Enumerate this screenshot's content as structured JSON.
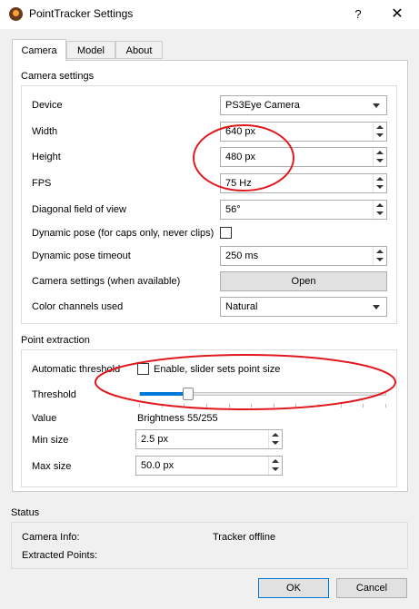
{
  "window": {
    "title": "PointTracker Settings",
    "help_label": "?",
    "close_label": "✕",
    "icon": "app-logo-icon"
  },
  "tabs": [
    {
      "label": "Camera",
      "active": true
    },
    {
      "label": "Model",
      "active": false
    },
    {
      "label": "About",
      "active": false
    }
  ],
  "camera": {
    "group_title": "Camera settings",
    "device": {
      "label": "Device",
      "value": "PS3Eye Camera"
    },
    "width": {
      "label": "Width",
      "value": "640 px"
    },
    "height": {
      "label": "Height",
      "value": "480 px"
    },
    "fps": {
      "label": "FPS",
      "value": "75 Hz"
    },
    "fov": {
      "label": "Diagonal field of view",
      "value": "56°"
    },
    "dynamic_pose": {
      "label": "Dynamic pose (for caps only, never clips)",
      "checked": false
    },
    "dynamic_timeout": {
      "label": "Dynamic pose timeout",
      "value": "250 ms"
    },
    "cam_settings": {
      "label": "Camera settings (when available)",
      "button": "Open"
    },
    "color": {
      "label": "Color channels used",
      "value": "Natural"
    }
  },
  "point_extraction": {
    "group_title": "Point extraction",
    "auto_threshold": {
      "label": "Automatic threshold",
      "checkbox_label": "Enable, slider sets point size",
      "checked": false
    },
    "threshold": {
      "label": "Threshold",
      "level_fraction": 0.2
    },
    "value": {
      "label": "Value",
      "text": "Brightness 55/255"
    },
    "min_size": {
      "label": "Min size",
      "value": "2.5 px"
    },
    "max_size": {
      "label": "Max size",
      "value": "50.0 px"
    }
  },
  "status": {
    "group_title": "Status",
    "camera_info_label": "Camera Info:",
    "camera_info_value": "Tracker offline",
    "extracted_points_label": "Extracted Points:"
  },
  "footer": {
    "ok": "OK",
    "cancel": "Cancel"
  },
  "colors": {
    "accent": "#0078d7",
    "annotation": "#e0191f"
  }
}
